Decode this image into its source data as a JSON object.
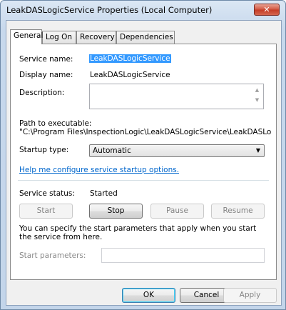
{
  "window": {
    "title": "LeakDASLogicService Properties (Local Computer)",
    "close_glyph": "✕"
  },
  "tabs": [
    {
      "label": "General",
      "active": true
    },
    {
      "label": "Log On",
      "active": false
    },
    {
      "label": "Recovery",
      "active": false
    },
    {
      "label": "Dependencies",
      "active": false
    }
  ],
  "general": {
    "service_name_label": "Service name:",
    "service_name_value": "LeakDASLogicService",
    "display_name_label": "Display name:",
    "display_name_value": "LeakDASLogicService",
    "description_label": "Description:",
    "description_value": "",
    "path_label": "Path to executable:",
    "path_value": "\"C:\\Program Files\\InspectionLogic\\LeakDASLogicService\\LeakDASLogicS",
    "startup_type_label": "Startup type:",
    "startup_type_value": "Automatic",
    "help_link": "Help me configure service startup options.",
    "service_status_label": "Service status:",
    "service_status_value": "Started",
    "start_button": "Start",
    "stop_button": "Stop",
    "pause_button": "Pause",
    "resume_button": "Resume",
    "hint_text": "You can specify the start parameters that apply when you start the service from here.",
    "start_params_label": "Start parameters:",
    "start_params_value": ""
  },
  "footer": {
    "ok": "OK",
    "cancel": "Cancel",
    "apply": "Apply"
  },
  "icons": {
    "scroll_up": "▲",
    "scroll_down": "▼",
    "dropdown": "▼"
  }
}
